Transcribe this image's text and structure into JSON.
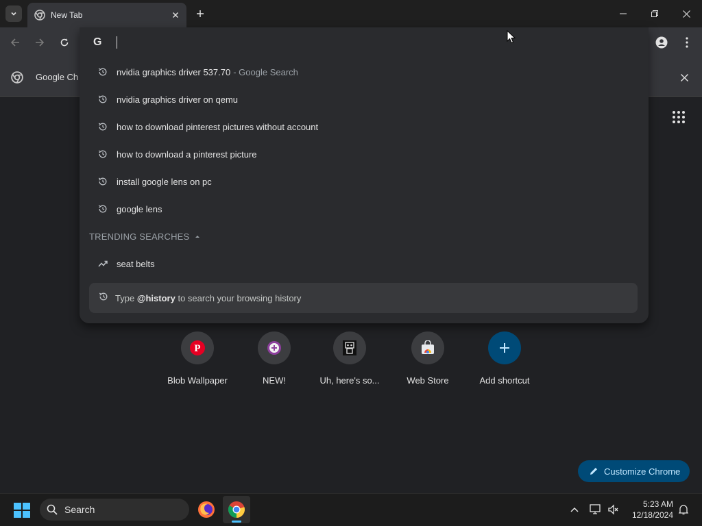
{
  "tab": {
    "title": "New Tab"
  },
  "infobar": {
    "text": "Google Ch"
  },
  "omnibox": {
    "value": "",
    "search_engine_icon": "google-g-icon"
  },
  "suggestions": [
    {
      "text": "nvidia graphics driver 537.70",
      "suffix": "- Google Search",
      "icon": "history-icon"
    },
    {
      "text": "nvidia graphics driver on qemu",
      "suffix": "",
      "icon": "history-icon"
    },
    {
      "text": "how to download pinterest pictures without account",
      "suffix": "",
      "icon": "history-icon"
    },
    {
      "text": "how to download a pinterest picture",
      "suffix": "",
      "icon": "history-icon"
    },
    {
      "text": "install google lens on pc",
      "suffix": "",
      "icon": "history-icon"
    },
    {
      "text": "google lens",
      "suffix": "",
      "icon": "history-icon"
    }
  ],
  "trending": {
    "header": "TRENDING SEARCHES",
    "items": [
      {
        "text": "seat belts",
        "icon": "trending-icon"
      }
    ]
  },
  "history_hint": {
    "prefix": "Type",
    "keyword": "@history",
    "suffix": "to search your browsing history"
  },
  "shortcuts": [
    {
      "label": "Blob Wallpaper",
      "icon": "pinterest-icon"
    },
    {
      "label": "NEW!",
      "icon": "plus-circle-icon"
    },
    {
      "label": "Uh, here's so...",
      "icon": "robot-icon"
    },
    {
      "label": "Web Store",
      "icon": "web-store-icon"
    },
    {
      "label": "Add shortcut",
      "icon": "add-icon"
    }
  ],
  "customize": {
    "label": "Customize Chrome"
  },
  "taskbar": {
    "search_label": "Search",
    "time": "5:23 AM",
    "date": "12/18/2024"
  },
  "colors": {
    "accent": "#004a77",
    "accent_text": "#c2e7ff",
    "background": "#202124"
  }
}
